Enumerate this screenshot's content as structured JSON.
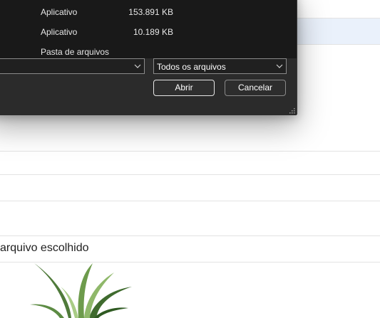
{
  "dialog": {
    "files": [
      {
        "type": "Aplicativo",
        "size": "153.891 KB"
      },
      {
        "type": "Aplicativo",
        "size": "10.189 KB"
      },
      {
        "type": "Pasta de arquivos",
        "size": ""
      }
    ],
    "filename_dropdown": {
      "value": ""
    },
    "filetype_dropdown": {
      "value": "Todos os arquivos"
    },
    "open_button": "Abrir",
    "cancel_button": "Cancelar",
    "colors": {
      "background": "#202020",
      "list": "#191919",
      "footer": "#2b2b2b",
      "text": "#e6e6e6"
    }
  },
  "page": {
    "status_text": "arquivo escolhido",
    "image": {
      "icon": "plant-image"
    }
  }
}
